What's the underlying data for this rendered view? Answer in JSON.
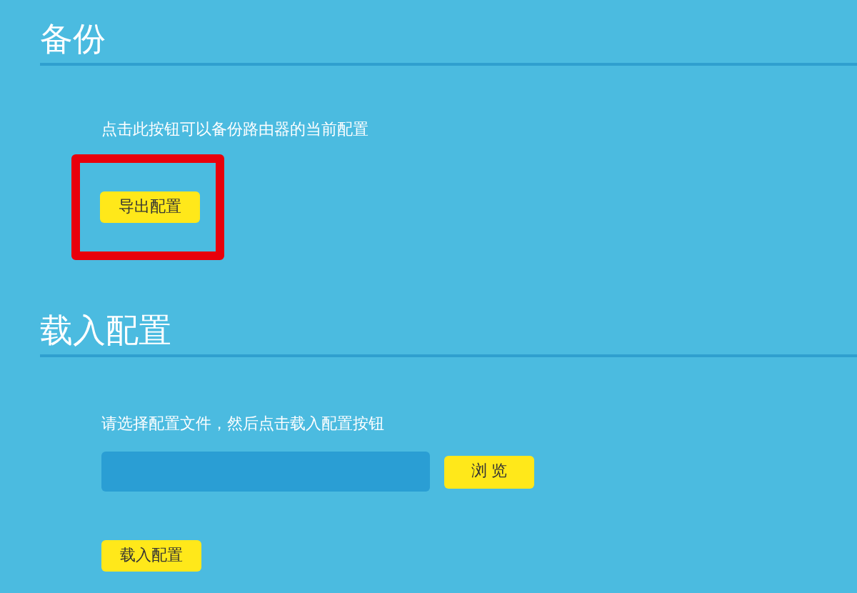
{
  "sections": [
    {
      "title": "备份",
      "description": "点击此按钮可以备份路由器的当前配置",
      "kind": "backup",
      "button": {
        "label": "导出配置",
        "highlighted": true
      }
    },
    {
      "title": "载入配置",
      "description": "请选择配置文件，然后点击载入配置按钮",
      "kind": "restore",
      "browse_button": {
        "label": "浏 览"
      },
      "button": {
        "label": "载入配置",
        "highlighted": false
      }
    }
  ]
}
